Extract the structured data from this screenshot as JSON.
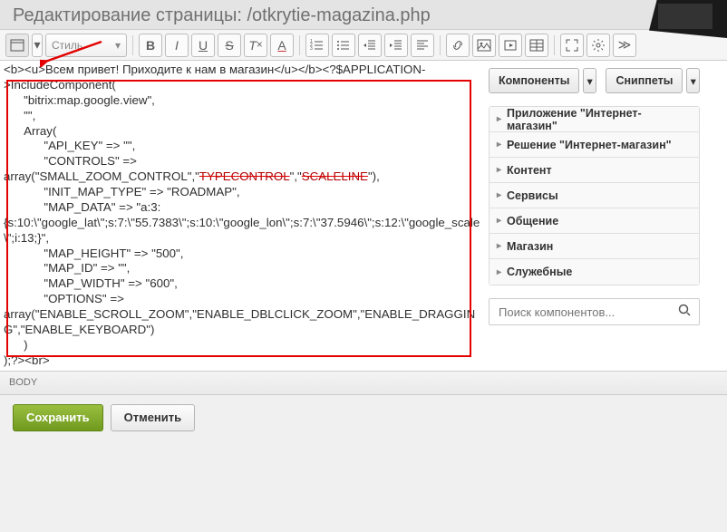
{
  "page_title": "Редактирование страницы: /otkrytie-magazina.php",
  "toolbar": {
    "style_label": "Стиль"
  },
  "code": {
    "line1": "<b><u>Всем привет! Приходите к нам в магазин</u></b><?$APPLICATION-",
    "line2": ">IncludeComponent(",
    "line3": "      \"bitrix:map.google.view\",",
    "line4": "      \"\",",
    "line5": "      Array(",
    "line6": "            \"API_KEY\" => \"\",",
    "line7a": "            \"CONTROLS\" =>",
    "line7b_pre": "array(\"SMALL_ZOOM_CONTROL\",\"",
    "line7b_err1": "TYPECONTROL",
    "line7b_mid": "\",\"",
    "line7b_err2": "SCALELINE",
    "line7b_post": "\"),",
    "line8": "            \"INIT_MAP_TYPE\" => \"ROADMAP\",",
    "line9": "            \"MAP_DATA\" => \"a:3:",
    "line10": "{s:10:\\\"google_lat\\\";s:7:\\\"55.7383\\\";s:10:\\\"google_lon\\\";s:7:\\\"37.5946\\\";s:12:\\\"google_scale\\\";i:13;}\",",
    "line11": "            \"MAP_HEIGHT\" => \"500\",",
    "line12": "            \"MAP_ID\" => \"\",",
    "line13": "            \"MAP_WIDTH\" => \"600\",",
    "line14": "            \"OPTIONS\" =>",
    "line15": "array(\"ENABLE_SCROLL_ZOOM\",\"ENABLE_DBLCLICK_ZOOM\",\"ENABLE_DRAGGING\",\"ENABLE_KEYBOARD\")",
    "line16": "      )",
    "line17": ");?><br>"
  },
  "side": {
    "components_btn": "Компоненты",
    "snippets_btn": "Сниппеты",
    "acc": [
      "Приложение \"Интернет-магазин\"",
      "Решение \"Интернет-магазин\"",
      "Контент",
      "Сервисы",
      "Общение",
      "Магазин",
      "Служебные"
    ],
    "search_placeholder": "Поиск компонентов..."
  },
  "status": {
    "body": "BODY"
  },
  "footer": {
    "save": "Сохранить",
    "cancel": "Отменить"
  }
}
